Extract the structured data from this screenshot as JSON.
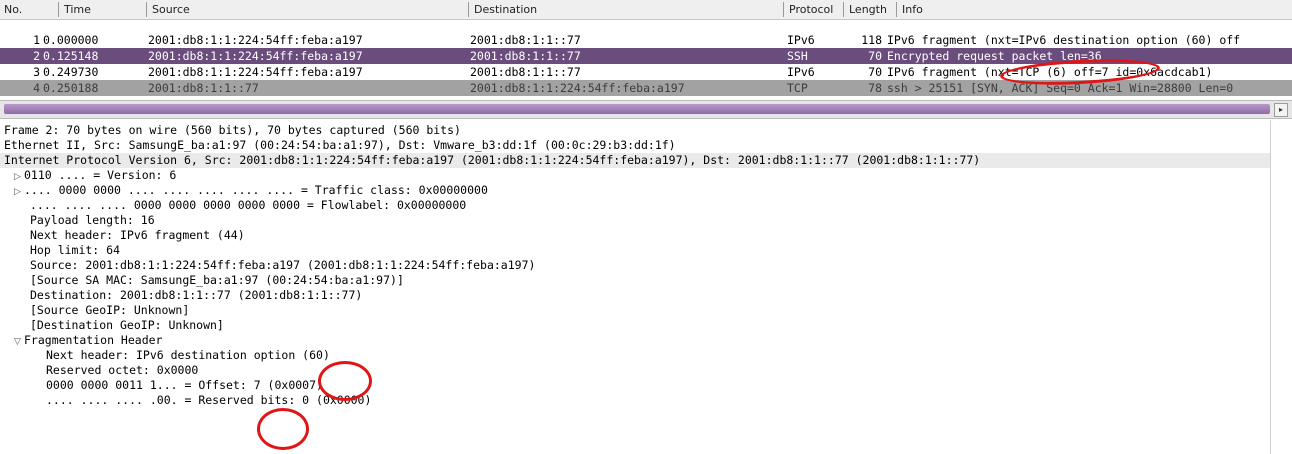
{
  "packet_list": {
    "columns": [
      "No.",
      "Time",
      "Source",
      "Destination",
      "Protocol",
      "Length",
      "Info"
    ],
    "rows": [
      {
        "no": "1",
        "time": "0.000000",
        "source": "2001:db8:1:1:224:54ff:feba:a197",
        "destination": "2001:db8:1:1::77",
        "protocol": "IPv6",
        "length": "118",
        "info": "IPv6 fragment (nxt=IPv6 destination option (60) off"
      },
      {
        "no": "2",
        "time": "0.125148",
        "source": "2001:db8:1:1:224:54ff:feba:a197",
        "destination": "2001:db8:1:1::77",
        "protocol": "SSH",
        "length": "70",
        "info": "Encrypted request packet len=36"
      },
      {
        "no": "3",
        "time": "0.249730",
        "source": "2001:db8:1:1:224:54ff:feba:a197",
        "destination": "2001:db8:1:1::77",
        "protocol": "IPv6",
        "length": "70",
        "info": "IPv6 fragment (nxt=TCP (6) off=7 id=0x6acdcab1)"
      },
      {
        "no": "4",
        "time": "0.250188",
        "source": "2001:db8:1:1::77",
        "destination": "2001:db8:1:1:224:54ff:feba:a197",
        "protocol": "TCP",
        "length": "78",
        "info": "ssh > 25151 [SYN, ACK] Seq=0 Ack=1 Win=28800 Len=0"
      }
    ],
    "row_colors": {
      "ipv6_bg": "#ffffff",
      "ssh_bg": "#6b4d7d",
      "tcp_bg": "#a2a2a2"
    },
    "scroll_right_icon": "arrow-right-icon"
  },
  "details": {
    "lines": [
      {
        "text": "Frame 2: 70 bytes on wire (560 bits), 70 bytes captured (560 bits)",
        "tw": ""
      },
      {
        "text": "Ethernet II, Src: SamsungE_ba:a1:97 (00:24:54:ba:a1:97), Dst: Vmware_b3:dd:1f (00:0c:29:b3:dd:1f)",
        "tw": ""
      },
      {
        "text": "Internet Protocol Version 6, Src: 2001:db8:1:1:224:54ff:feba:a197 (2001:db8:1:1:224:54ff:feba:a197), Dst: 2001:db8:1:1::77 (2001:db8:1:1::77)",
        "tw": ""
      },
      {
        "text": "0110 .... = Version: 6",
        "tw": "▷"
      },
      {
        "text": ".... 0000 0000 .... .... .... .... .... = Traffic class: 0x00000000",
        "tw": "▷"
      },
      {
        "text": ".... .... .... 0000 0000 0000 0000 0000 = Flowlabel: 0x00000000",
        "tw": ""
      },
      {
        "text": "Payload length: 16",
        "tw": ""
      },
      {
        "text": "Next header: IPv6 fragment (44)",
        "tw": ""
      },
      {
        "text": "Hop limit: 64",
        "tw": ""
      },
      {
        "text": "Source: 2001:db8:1:1:224:54ff:feba:a197 (2001:db8:1:1:224:54ff:feba:a197)",
        "tw": ""
      },
      {
        "text": "[Source SA MAC: SamsungE_ba:a1:97 (00:24:54:ba:a1:97)]",
        "tw": ""
      },
      {
        "text": "Destination: 2001:db8:1:1::77 (2001:db8:1:1::77)",
        "tw": ""
      },
      {
        "text": "[Source GeoIP: Unknown]",
        "tw": ""
      },
      {
        "text": "[Destination GeoIP: Unknown]",
        "tw": ""
      },
      {
        "text": "Fragmentation Header",
        "tw": "▽"
      },
      {
        "text": "Next header: IPv6 destination option (60)",
        "tw": ""
      },
      {
        "text": "Reserved octet: 0x0000",
        "tw": ""
      },
      {
        "text": "0000 0000 0011 1... = Offset: 7 (0x0007)",
        "tw": ""
      },
      {
        "text": ".... .... .... .00. = Reserved bits: 0 (0x0000)",
        "tw": ""
      }
    ]
  },
  "annotation_color": "#e01515"
}
